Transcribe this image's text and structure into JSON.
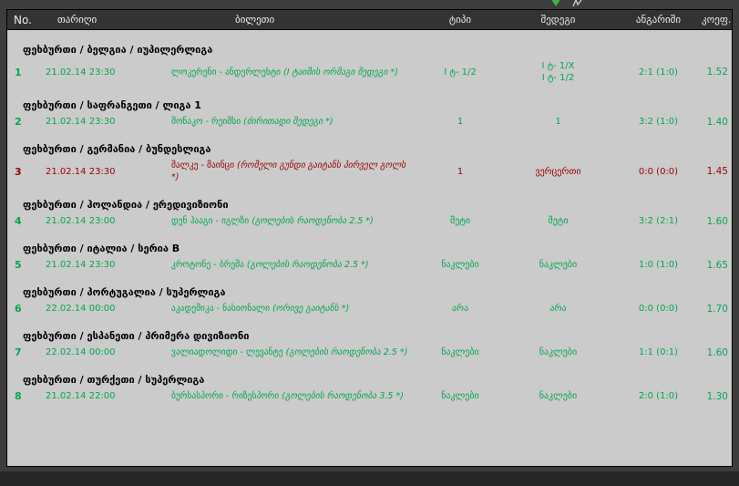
{
  "colors": {
    "won": "#00a651",
    "lost": "#990000",
    "body_bg": "#cbcbcb",
    "frame_bg": "#3d3d3d",
    "header_bg": "#333333"
  },
  "top_icons": {
    "arrow": "green-down-arrow",
    "cursor": "pointer-glyph"
  },
  "table": {
    "columns": {
      "no": "No.",
      "date": "თარიღი",
      "ticket": "ბილეთი",
      "type": "ტიპი",
      "result": "შედეგი",
      "score": "ანგარიში",
      "coef": "კოეფ."
    },
    "groups": [
      {
        "category": "ფეხბურთი / ბელგია / იუპილერლიგა",
        "row": {
          "no": "1",
          "date": "21.02.14 23:30",
          "teams": "ლოკერენი - ანდერლეხტი ",
          "bet": "(I ტაიმის ორმაგი შედეგი *)",
          "type": "I ტ- 1/2",
          "result": "I ტ- 1/X\nI ტ- 1/2",
          "score": "2:1 (1:0)",
          "coef": "1.52",
          "status": "won"
        }
      },
      {
        "category": "ფეხბურთი / საფრანგეთი / ლიგა 1",
        "row": {
          "no": "2",
          "date": "21.02.14 23:30",
          "teams": "მონაკო - რეიმსი ",
          "bet": "(ძირითადი შედეგი *)",
          "type": "1",
          "result": "1",
          "score": "3:2 (1:0)",
          "coef": "1.40",
          "status": "won"
        }
      },
      {
        "category": "ფეხბურთი / გერმანია / ბუნდესლიგა",
        "row": {
          "no": "3",
          "date": "21.02.14 23:30",
          "teams": "შალკე - მაინცი ",
          "bet": "(რომელი გუნდი გაიტანს პირველ გოლს *)",
          "type": "1",
          "result": "ვერცერთი",
          "score": "0:0 (0:0)",
          "coef": "1.45",
          "status": "lost"
        }
      },
      {
        "category": "ფეხბურთი / ჰოლანდია / ერედივიზიონი",
        "row": {
          "no": "4",
          "date": "21.02.14 23:00",
          "teams": "დენ ჰააგი - იგლზი ",
          "bet": "(გოლების რაოდენობა 2.5 *)",
          "type": "მეტი",
          "result": "მეტი",
          "score": "3:2 (2:1)",
          "coef": "1.60",
          "status": "won"
        }
      },
      {
        "category": "ფეხბურთი / იტალია / სერია B",
        "row": {
          "no": "5",
          "date": "21.02.14 23:30",
          "teams": "კროტონე - ბრეშა ",
          "bet": "(გოლების რაოდენობა 2.5 *)",
          "type": "ნაკლები",
          "result": "ნაკლები",
          "score": "1:0 (1:0)",
          "coef": "1.65",
          "status": "won"
        }
      },
      {
        "category": "ფეხბურთი / პორტუგალია / სუპერლიგა",
        "row": {
          "no": "6",
          "date": "22.02.14 00:00",
          "teams": "აკადემიკა - ნასიონალი ",
          "bet": "(ორივე გაიტანს *)",
          "type": "არა",
          "result": "არა",
          "score": "0:0 (0:0)",
          "coef": "1.70",
          "status": "won"
        }
      },
      {
        "category": "ფეხბურთი / ესპანეთი / პრიმერა დივიზიონი",
        "row": {
          "no": "7",
          "date": "22.02.14 00:00",
          "teams": "ვალიადოლიდი - ლევანტე ",
          "bet": "(გოლების რაოდენობა 2.5 *)",
          "type": "ნაკლები",
          "result": "ნაკლები",
          "score": "1:1 (0:1)",
          "coef": "1.60",
          "status": "won"
        }
      },
      {
        "category": "ფეხბურთი / თურქეთი / სუპერლიგა",
        "row": {
          "no": "8",
          "date": "21.02.14 22:00",
          "teams": "ბურსასპორი - რიზესპორი ",
          "bet": "(გოლების რაოდენობა 3.5 *)",
          "type": "ნაკლები",
          "result": "ნაკლები",
          "score": "2:0 (1:0)",
          "coef": "1.30",
          "status": "won"
        }
      }
    ]
  }
}
